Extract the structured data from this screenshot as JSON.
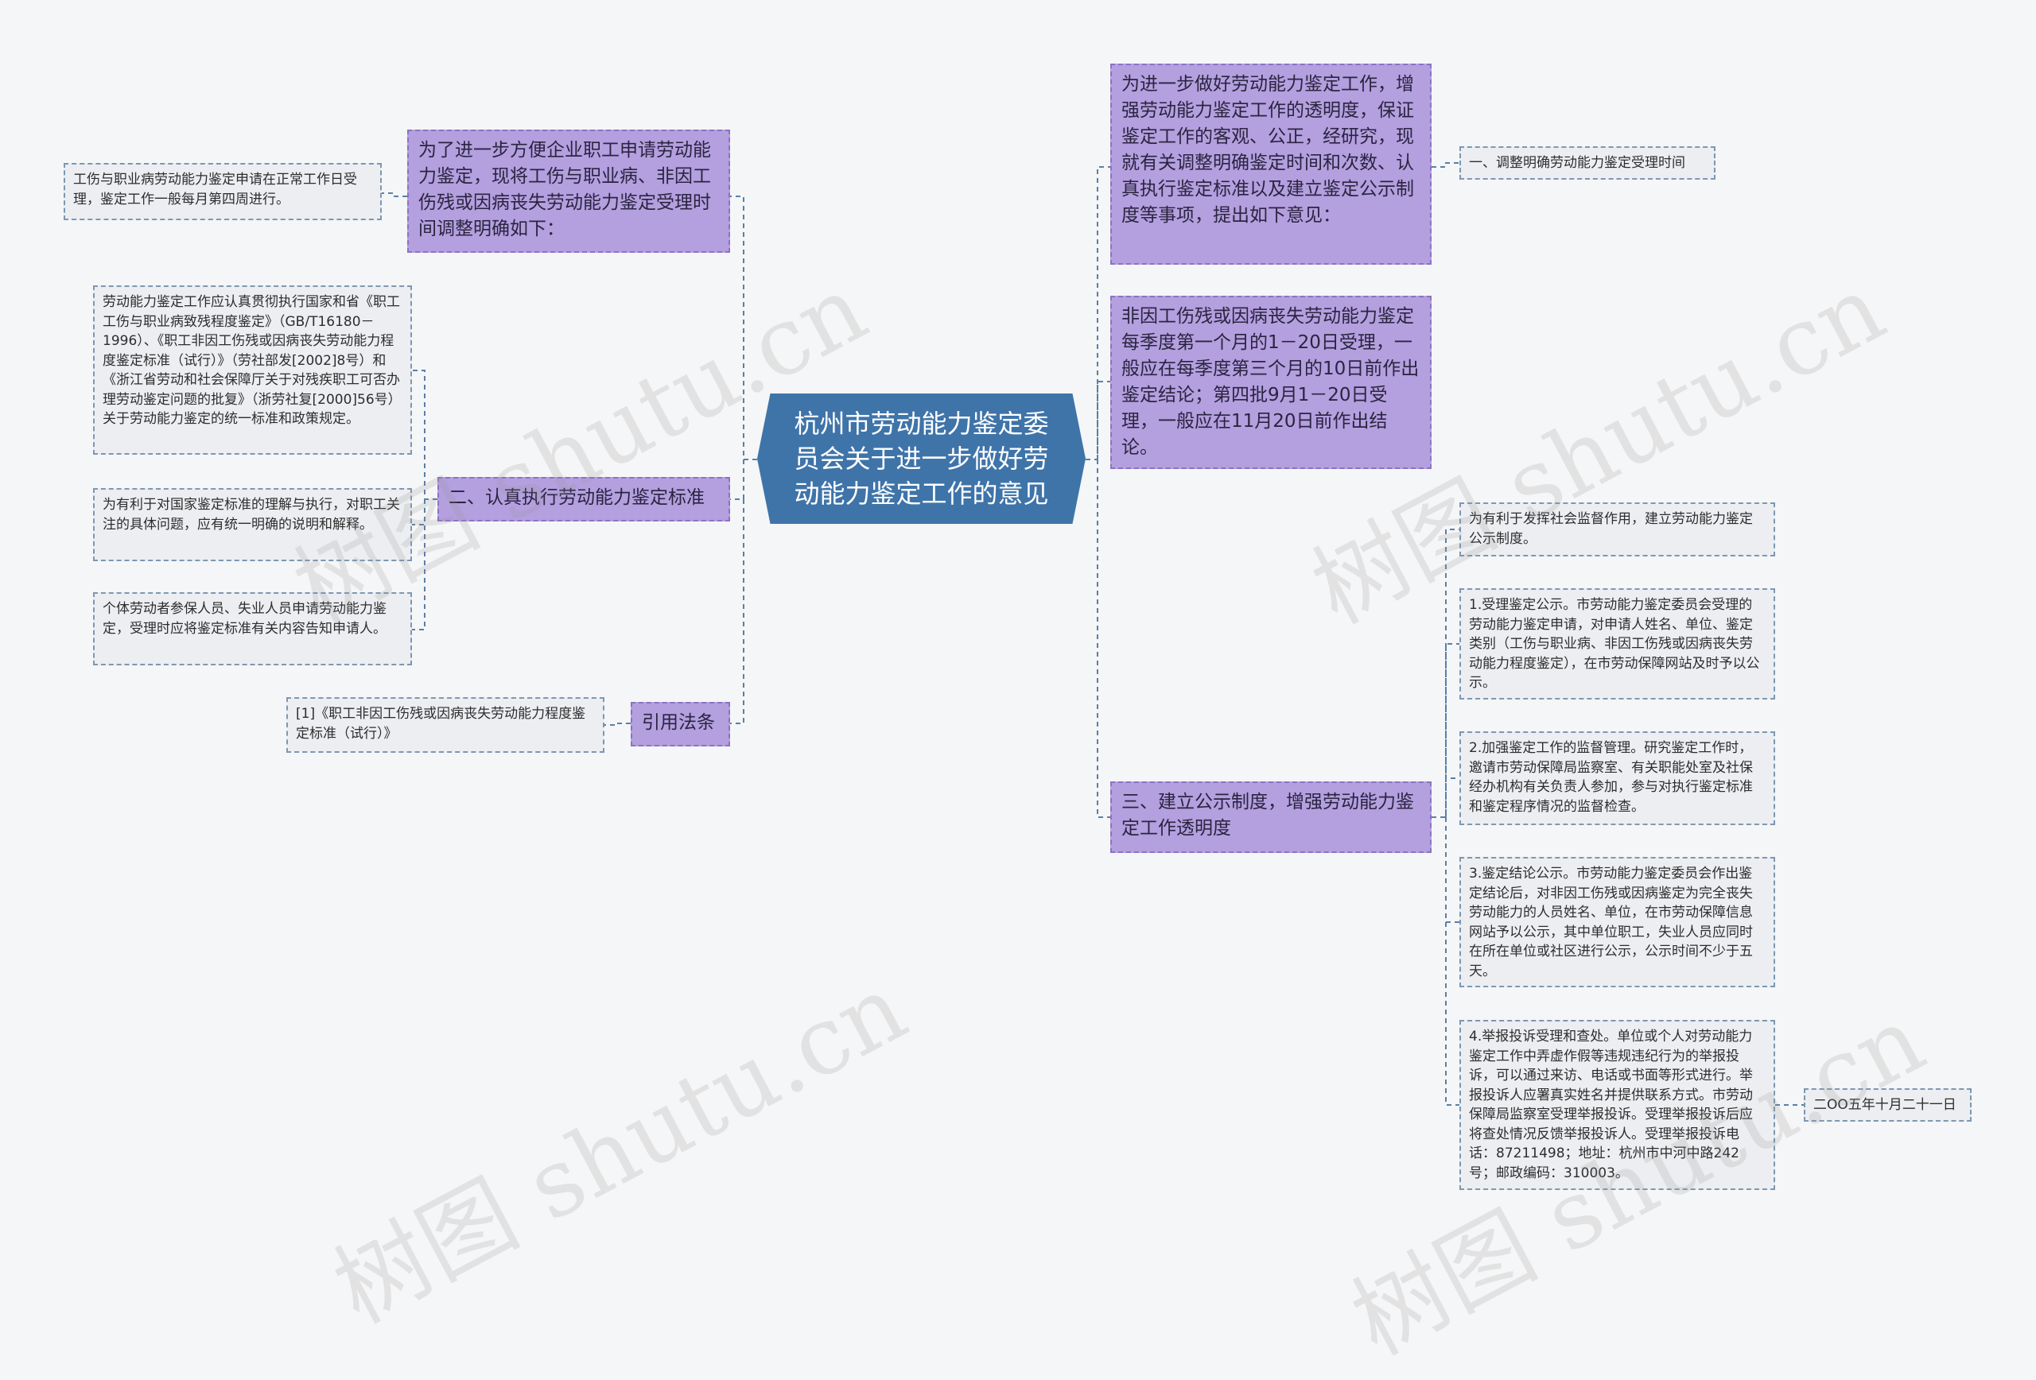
{
  "root": "杭州市劳动能力鉴定委员会关于进一步做好劳动能力鉴定工作的意见",
  "left": {
    "b1": {
      "label": "为了进一步方便企业职工申请劳动能力鉴定，现将工伤与职业病、非因工伤残或因病丧失劳动能力鉴定受理时间调整明确如下：",
      "leaf": "工伤与职业病劳动能力鉴定申请在正常工作日受理，鉴定工作一般每月第四周进行。"
    },
    "b2": {
      "label": "二、认真执行劳动能力鉴定标准",
      "leaves": [
        "劳动能力鉴定工作应认真贯彻执行国家和省《职工工伤与职业病致残程度鉴定》（GB/T16180－1996）、《职工非因工伤残或因病丧失劳动能力程度鉴定标准（试行）》（劳社部发[2002]8号）和《浙江省劳动和社会保障厅关于对残疾职工可否办理劳动鉴定问题的批复》（浙劳社复[2000]56号）关于劳动能力鉴定的统一标准和政策规定。",
        "为有利于对国家鉴定标准的理解与执行，对职工关注的具体问题，应有统一明确的说明和解释。",
        "个体劳动者参保人员、失业人员申请劳动能力鉴定，受理时应将鉴定标准有关内容告知申请人。"
      ]
    },
    "b3": {
      "label": "引用法条",
      "leaf": "[1]《职工非因工伤残或因病丧失劳动能力程度鉴定标准（试行）》"
    }
  },
  "right": {
    "b1": {
      "label": "为进一步做好劳动能力鉴定工作，增强劳动能力鉴定工作的透明度，保证鉴定工作的客观、公正，经研究，现就有关调整明确鉴定时间和次数、认真执行鉴定标准以及建立鉴定公示制度等事项，提出如下意见：",
      "leaf": "一、调整明确劳动能力鉴定受理时间"
    },
    "b2": {
      "label": "非因工伤残或因病丧失劳动能力鉴定每季度第一个月的1－20日受理，一般应在每季度第三个月的10日前作出鉴定结论；第四批9月1－20日受理，一般应在11月20日前作出结论。"
    },
    "b3": {
      "label": "三、建立公示制度，增强劳动能力鉴定工作透明度",
      "leaves": [
        "为有利于发挥社会监督作用，建立劳动能力鉴定公示制度。",
        "1.受理鉴定公示。市劳动能力鉴定委员会受理的劳动能力鉴定申请，对申请人姓名、单位、鉴定类别（工伤与职业病、非因工伤残或因病丧失劳动能力程度鉴定），在市劳动保障网站及时予以公示。",
        "2.加强鉴定工作的监督管理。研究鉴定工作时，邀请市劳动保障局监察室、有关职能处室及社保经办机构有关负责人参加，参与对执行鉴定标准和鉴定程序情况的监督检查。",
        "3.鉴定结论公示。市劳动能力鉴定委员会作出鉴定结论后，对非因工伤残或因病鉴定为完全丧失劳动能力的人员姓名、单位，在市劳动保障信息网站予以公示，其中单位职工，失业人员应同时在所在单位或社区进行公示，公示时间不少于五天。",
        "4.举报投诉受理和查处。单位或个人对劳动能力鉴定工作中弄虚作假等违规违纪行为的举报投诉，可以通过来访、电话或书面等形式进行。举报投诉人应署真实姓名并提供联系方式。市劳动保障局监察室受理举报投诉。受理举报投诉后应将查处情况反馈举报投诉人。受理举报投诉电话：87211498；地址：杭州市中河中路242号；邮政编码：310003。"
      ],
      "date": "二OO五年十月二十一日"
    }
  },
  "watermark": "树图 shutu.cn",
  "colors": {
    "background": "#f5f6f7",
    "root": "#3f74a9",
    "branch": "#b49fdf",
    "leaf": "#eceef1",
    "connector": "#5b7fa6"
  }
}
